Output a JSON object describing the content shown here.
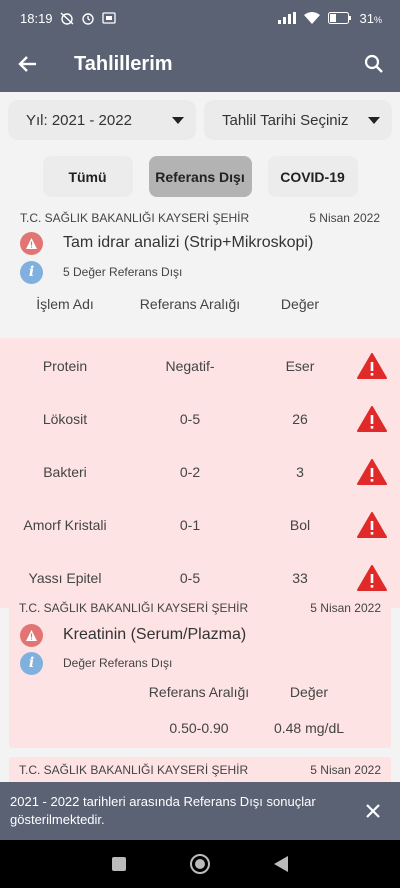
{
  "status": {
    "time": "18:19",
    "battery": "31"
  },
  "appbar": {
    "title": "Tahlillerim"
  },
  "filters": {
    "year": "Yıl: 2021 - 2022",
    "date": "Tahlil Tarihi Seçiniz"
  },
  "tabs": [
    "Tümü",
    "Referans Dışı",
    "COVID-19"
  ],
  "card1": {
    "institution": "T.C. SAĞLIK BAKANLIĞI KAYSERİ ŞEHİR",
    "date": "5 Nisan 2022",
    "test": "Tam idrar analizi (Strip+Mikroskopi)",
    "count": "5 Değer Referans Dışı",
    "headers": [
      "İşlem Adı",
      "Referans Aralığı",
      "Değer"
    ],
    "rows": [
      {
        "name": "Protein",
        "range": "Negatif-",
        "value": "Eser"
      },
      {
        "name": "Lökosit",
        "range": "0-5",
        "value": "26"
      },
      {
        "name": "Bakteri",
        "range": "0-2",
        "value": "3"
      },
      {
        "name": "Amorf Kristali",
        "range": "0-1",
        "value": "Bol"
      },
      {
        "name": "Yassı Epitel",
        "range": "0-5",
        "value": "33"
      }
    ]
  },
  "card2": {
    "institution": "T.C. SAĞLIK BAKANLIĞI KAYSERİ ŞEHİR",
    "date": "5 Nisan 2022",
    "test": "Kreatinin (Serum/Plazma)",
    "count": "Değer Referans Dışı",
    "headers": [
      "Referans Aralığı",
      "Değer"
    ],
    "range": "0.50-0.90",
    "value": "0.48 mg/dL"
  },
  "card3": {
    "institution": "T.C. SAĞLIK BAKANLIĞI KAYSERİ ŞEHİR",
    "date": "5 Nisan 2022"
  },
  "snackbar": {
    "message": "2021 - 2022 tarihleri arasında Referans Dışı sonuçlar gösterilmektedir."
  },
  "colors": {
    "primary": "#5a6274",
    "alert_bg": "#fde3e3",
    "warn": "#e02a2a",
    "info": "#7fb0de"
  }
}
